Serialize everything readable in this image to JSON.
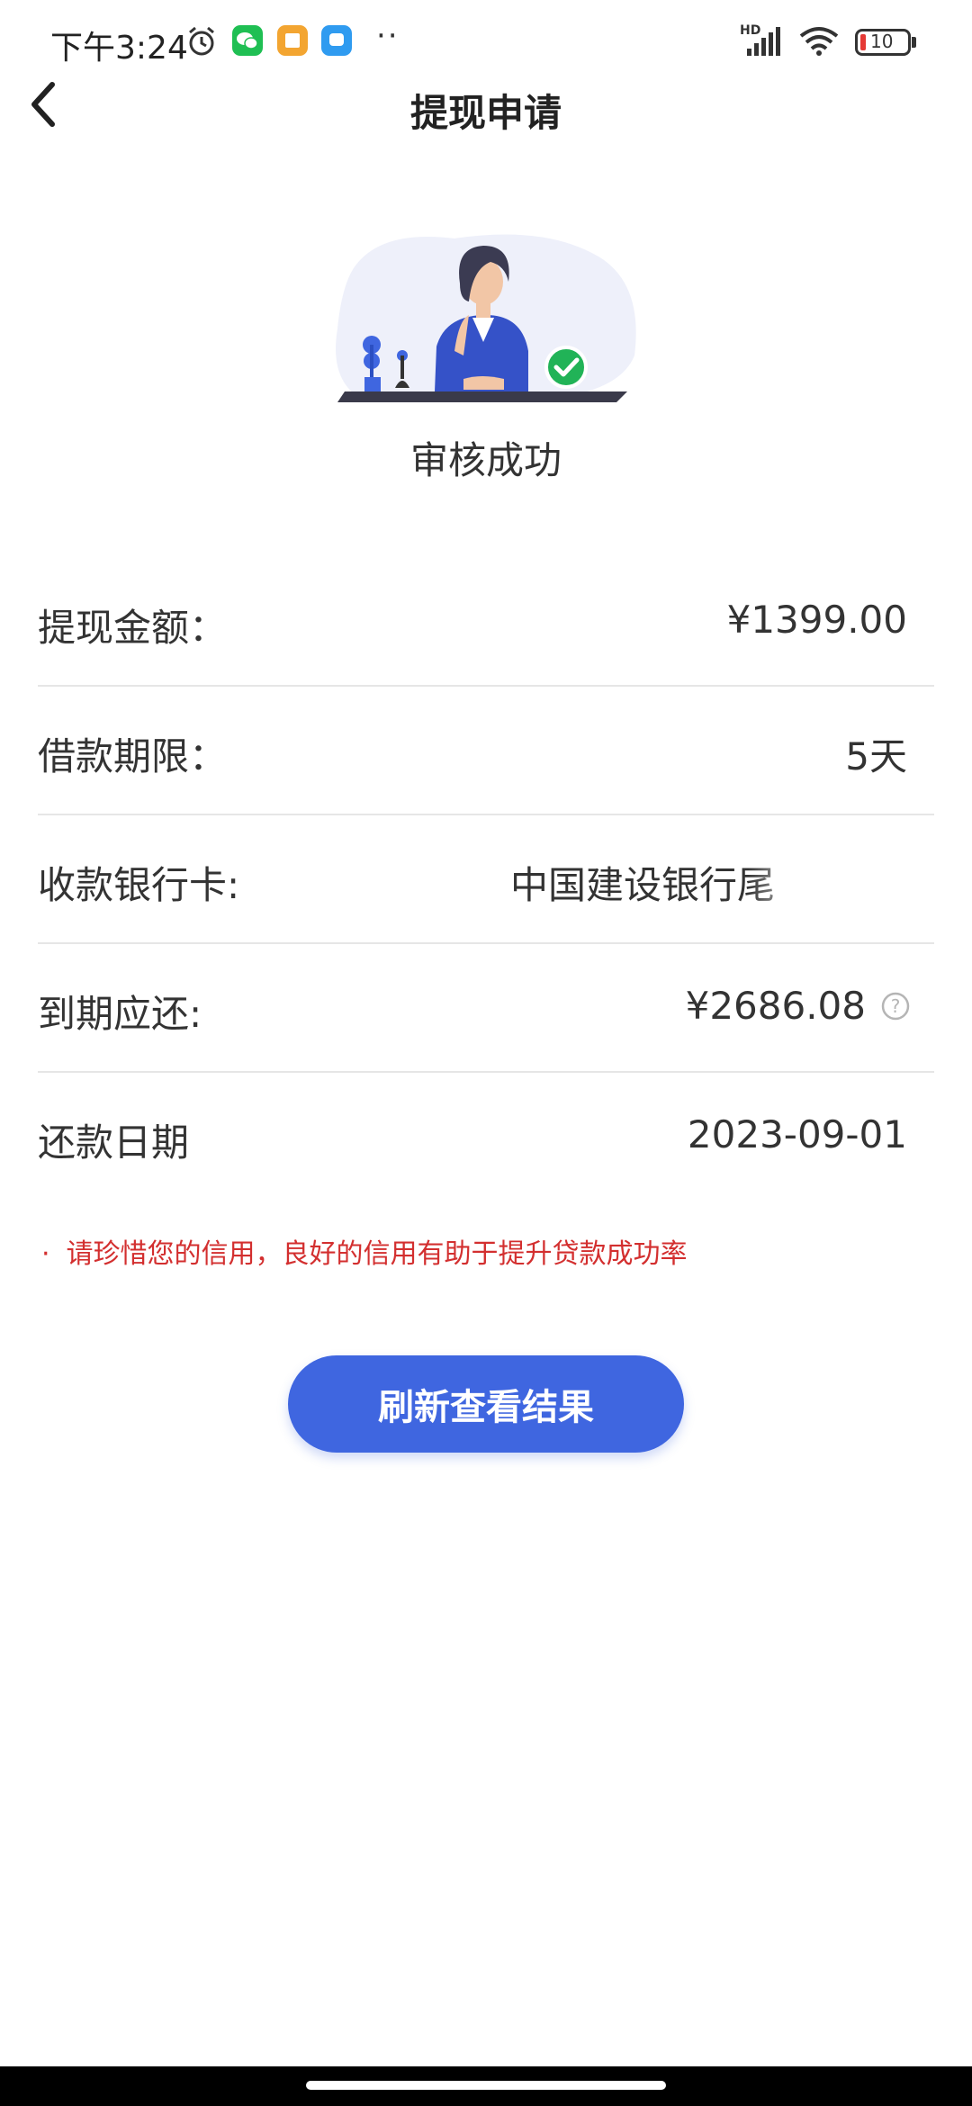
{
  "status_bar": {
    "time": "下午3:24",
    "network": "HD",
    "battery_level": "10",
    "more": "··"
  },
  "nav": {
    "title": "提现申请"
  },
  "result": {
    "status_text": "审核成功"
  },
  "rows": [
    {
      "label": "提现金额：",
      "value": "¥1399.00"
    },
    {
      "label": "借款期限：",
      "value": "5天"
    },
    {
      "label": "收款银行卡:",
      "value": "中国建设银行尾"
    },
    {
      "label": "到期应还:",
      "value": "¥2686.08"
    },
    {
      "label": "还款日期",
      "value": "2023-09-01"
    }
  ],
  "notice": {
    "dot": "·",
    "text": "请珍惜您的信用，良好的信用有助于提升贷款成功率"
  },
  "refresh_button": {
    "label": "刷新查看结果"
  },
  "colors": {
    "accent": "#3f66e0",
    "notice": "#d32f2f",
    "success": "#21b357"
  }
}
